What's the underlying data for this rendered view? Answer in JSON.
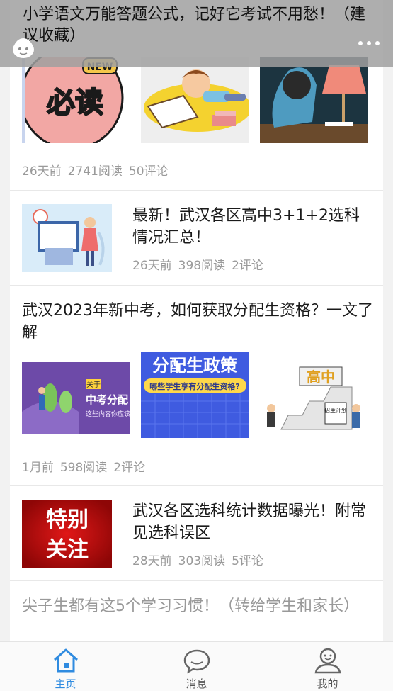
{
  "header": {
    "title": "小学语文万能答题公式，记好它考试不用愁！（建议收藏）",
    "avatar_icon": "child-face-icon",
    "more_icon": "more-dots-icon"
  },
  "articles": [
    {
      "type": "three-images",
      "thumb_labels": [
        "必读",
        "NEW"
      ],
      "time": "26天前",
      "reads": "2741阅读",
      "comments": "50评论"
    },
    {
      "type": "left-image",
      "title": "最新！武汉各区高中3+1+2选科情况汇总！",
      "time": "26天前",
      "reads": "398阅读",
      "comments": "2评论"
    },
    {
      "type": "three-images",
      "title": "武汉2023年新中考，如何获取分配生资格？一文了解",
      "thumb_texts": [
        "关于",
        "中考分配",
        "这些内容你应该",
        "分配生政策",
        "哪些学生享有分配生资格?",
        "高中",
        "招生计划"
      ],
      "time": "1月前",
      "reads": "598阅读",
      "comments": "2评论"
    },
    {
      "type": "left-image",
      "title": "武汉各区选科统计数据曝光！附常见选科误区",
      "thumb_texts": [
        "特别",
        "关注"
      ],
      "time": "28天前",
      "reads": "303阅读",
      "comments": "5评论"
    },
    {
      "type": "title-only",
      "title": "尖子生都有这5个学习习惯！（转给学生和家长）"
    }
  ],
  "tabbar": [
    {
      "label": "主页",
      "icon": "home-icon",
      "active": true
    },
    {
      "label": "消息",
      "icon": "message-bubble-icon",
      "active": false
    },
    {
      "label": "我的",
      "icon": "user-profile-icon",
      "active": false
    }
  ],
  "colors": {
    "accent": "#2f8be0",
    "meta": "#9a9a9a"
  }
}
